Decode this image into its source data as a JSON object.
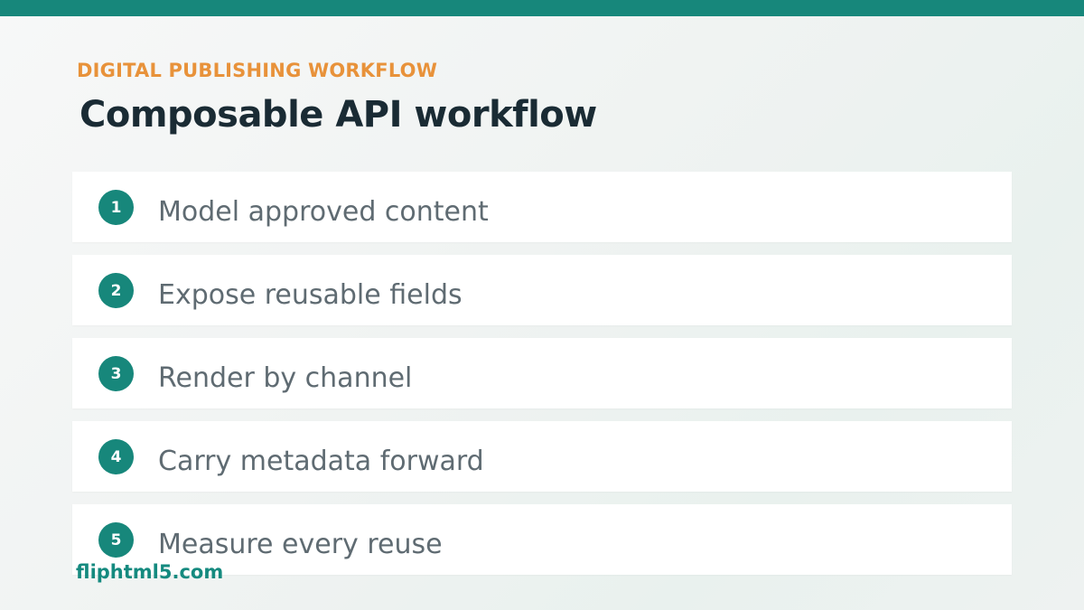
{
  "colors": {
    "accent_teal": "#17877b",
    "eyebrow_orange": "#e8923a",
    "title_dark": "#1a2b34",
    "step_text": "#5f6b72",
    "watermark": "#158a7f"
  },
  "header": {
    "eyebrow": "DIGITAL PUBLISHING WORKFLOW",
    "title": "Composable API workflow"
  },
  "steps": [
    {
      "number": "1",
      "label": "Model approved content"
    },
    {
      "number": "2",
      "label": "Expose reusable fields"
    },
    {
      "number": "3",
      "label": "Render by channel"
    },
    {
      "number": "4",
      "label": "Carry metadata forward"
    },
    {
      "number": "5",
      "label": "Measure every reuse"
    }
  ],
  "watermark": "fliphtml5.com"
}
